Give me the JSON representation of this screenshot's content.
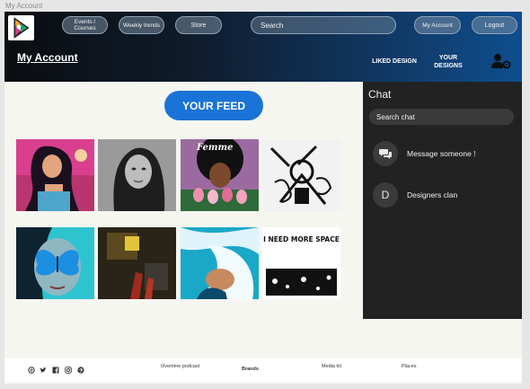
{
  "frame": {
    "title": "My Account"
  },
  "header": {
    "nav": {
      "events": "Events /\nCourses",
      "trends": "Weekly trends",
      "store": "Store",
      "my_account": "My Account",
      "logout": "Logout"
    },
    "search": {
      "placeholder": "Search"
    },
    "page_title": "My Account",
    "liked_designs": "LIKED DESIGN",
    "your_designs": "YOUR\nDESIGNS",
    "icons": {
      "logo": "brand-logo-icon",
      "profile": "user-settings-icon"
    }
  },
  "feed": {
    "button_label": "YOUR FEED",
    "artworks": [
      {
        "subject": "woman-with-long-hair-pink-background"
      },
      {
        "subject": "grayscale-portrait"
      },
      {
        "subject": "afro-portrait-with-tulips",
        "caption": "Femme"
      },
      {
        "subject": "black-and-white-line-art"
      },
      {
        "subject": "face-with-blue-butterfly"
      },
      {
        "subject": "dark-abstract-figure"
      },
      {
        "subject": "wave-portrait"
      },
      {
        "subject": "typographic-poster",
        "caption": "I NEED MORE SPACE"
      }
    ]
  },
  "chat": {
    "title": "Chat",
    "search_placeholder": "Search chat",
    "items": [
      {
        "avatar": "",
        "icon": "chat-bubbles-icon",
        "label": "Message someone !"
      },
      {
        "avatar": "D",
        "label": "Designers clan"
      }
    ]
  },
  "footer": {
    "social": [
      "pinterest-like-icon",
      "twitter-icon",
      "facebook-icon",
      "instagram-icon",
      "pinterest-icon"
    ],
    "links": {
      "podcast": "Overtime podcast",
      "brands": "Brands",
      "media": "Media kit",
      "places": "Places"
    }
  }
}
